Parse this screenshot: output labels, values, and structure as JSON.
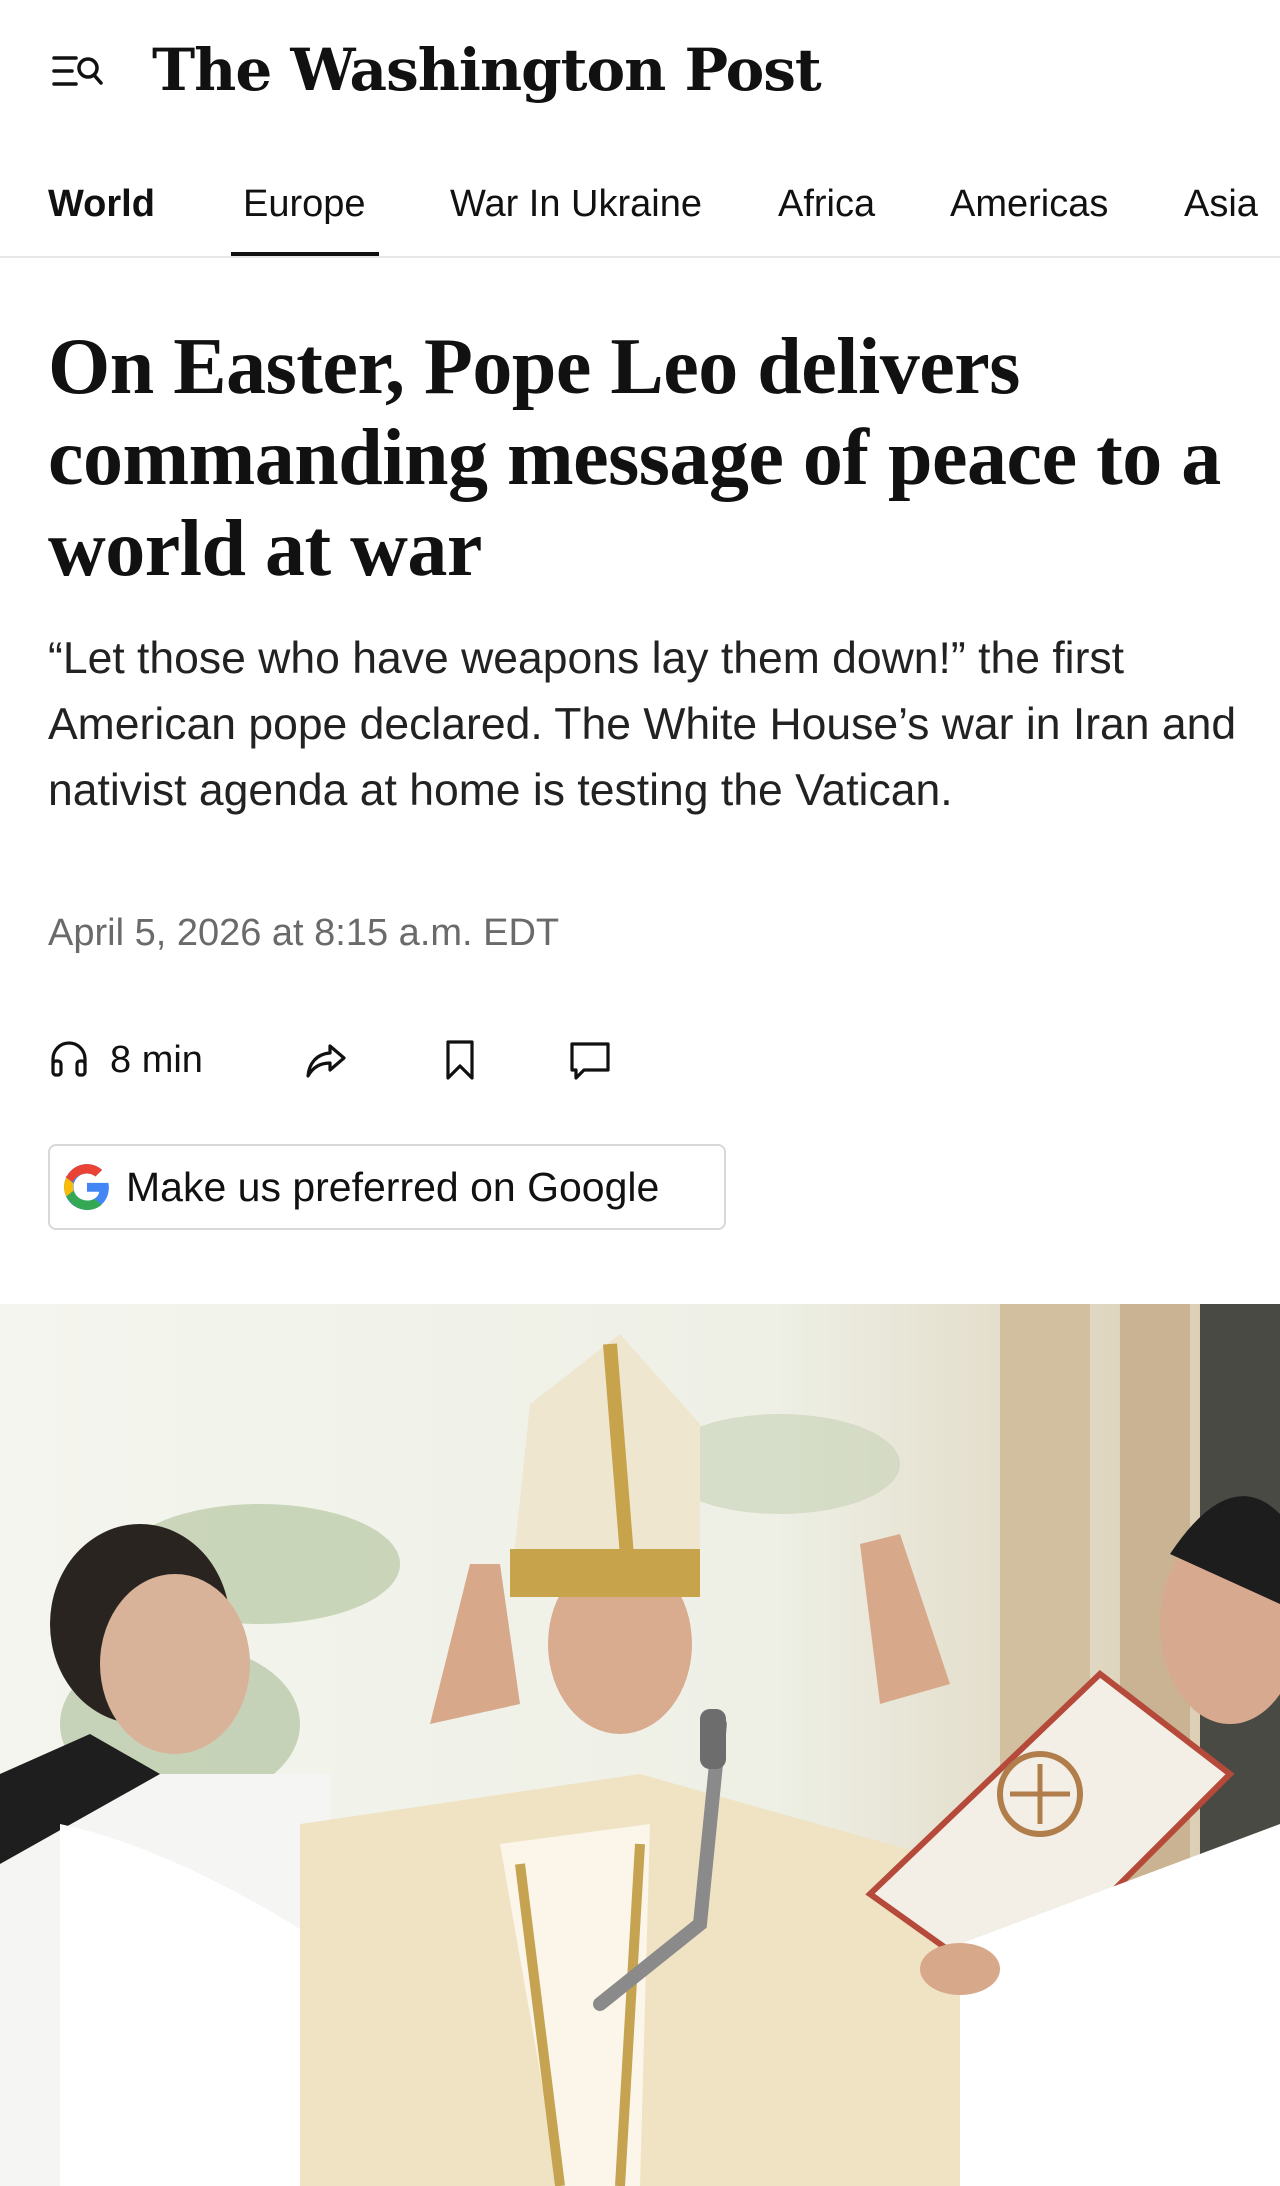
{
  "header": {
    "logo_text": "The Washington Post",
    "menu_icon": "menu-search-icon"
  },
  "nav": {
    "items": [
      {
        "label": "World",
        "active": false,
        "bold": true
      },
      {
        "label": "Europe",
        "active": true,
        "bold": false
      },
      {
        "label": "War In Ukraine",
        "active": false,
        "bold": false
      },
      {
        "label": "Africa",
        "active": false,
        "bold": false
      },
      {
        "label": "Americas",
        "active": false,
        "bold": false
      },
      {
        "label": "Asia",
        "active": false,
        "bold": false
      }
    ]
  },
  "article": {
    "headline": "On Easter, Pope Leo delivers commanding message of peace to a world at war",
    "dek": "“Let those who have weapons lay them down!” the first American pope declared. The White House’s war in Iran and nativist agenda at home is testing the Vatican.",
    "timestamp": "April 5, 2026 at 8:15 a.m. EDT"
  },
  "actions": {
    "listen_label": "8 min",
    "listen_icon": "headphones-icon",
    "share_icon": "share-icon",
    "save_icon": "bookmark-icon",
    "comment_icon": "comment-icon"
  },
  "google_button": {
    "label": "Make us preferred on Google",
    "icon": "google-g-icon"
  },
  "colors": {
    "text": "#111111",
    "dek": "#222222",
    "meta": "#6a6a6a",
    "divider": "#e8e8e8",
    "button_border": "#d8d8d8",
    "google_blue": "#4285F4",
    "google_red": "#EA4335",
    "google_yellow": "#FBBC05",
    "google_green": "#34A853"
  }
}
